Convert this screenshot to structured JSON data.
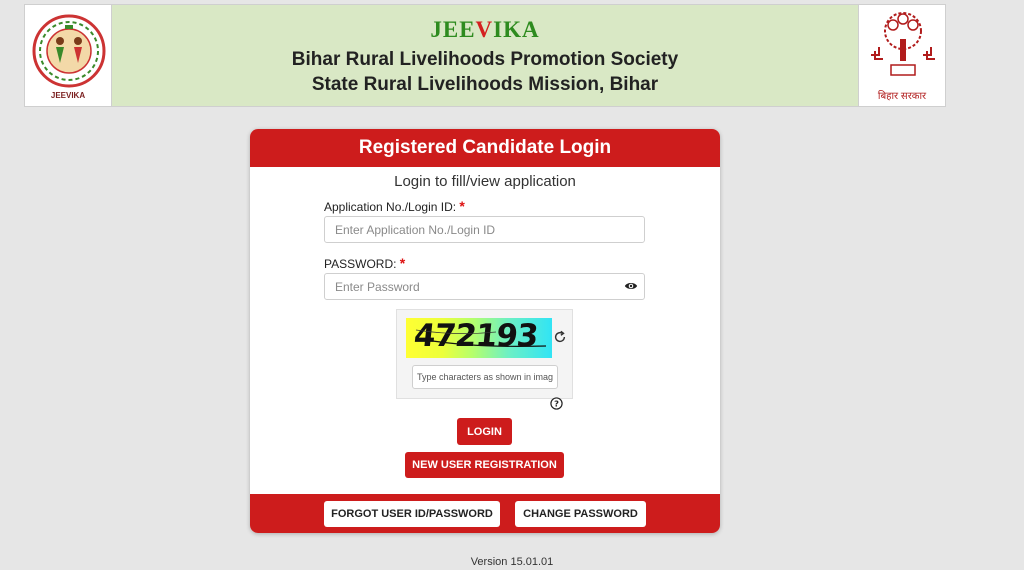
{
  "header": {
    "brand_left": "JEE",
    "brand_mid": "V",
    "brand_right": "IKA",
    "org_line1": "Bihar Rural Livelihoods Promotion Society",
    "org_line2": "State Rural Livelihoods Mission, Bihar",
    "left_logo_caption": "JEEVIKA",
    "right_logo_caption": "बिहार सरकार"
  },
  "login": {
    "title": "Registered Candidate Login",
    "subtitle": "Login to fill/view application",
    "app_label": "Application No./Login ID:",
    "app_placeholder": "Enter Application No./Login ID",
    "password_label": "PASSWORD:",
    "password_placeholder": "Enter Password",
    "required_mark": "*",
    "captcha_text": "472193",
    "captcha_placeholder": "Type characters as shown in image",
    "login_button": "LOGIN",
    "register_button": "NEW USER REGISTRATION",
    "forgot_button": "FORGOT USER ID/PASSWORD",
    "change_password_button": "CHANGE PASSWORD"
  },
  "footer": {
    "version": "Version 15.01.01"
  },
  "colors": {
    "primary_red": "#cd1c1c",
    "banner_green": "#d9e8c5",
    "brand_green": "#2e8b1f"
  },
  "icons": {
    "password_toggle": "eye-icon",
    "captcha_refresh": "refresh-icon",
    "captcha_help": "question-circle-icon"
  }
}
